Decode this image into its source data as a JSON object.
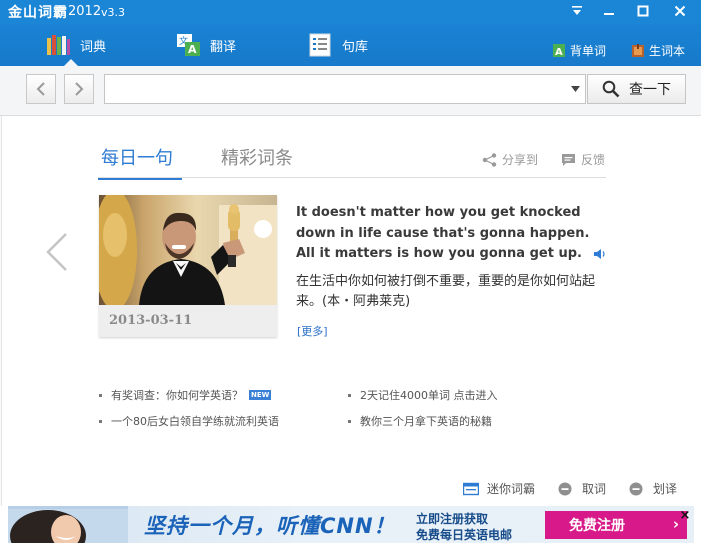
{
  "titlebar": {
    "logo": "金山词霸",
    "year": "2012",
    "version": "v3.3"
  },
  "toolbar": {
    "tabs": [
      {
        "label": "词典",
        "icon": "books-icon"
      },
      {
        "label": "翻译",
        "icon": "translate-icon"
      },
      {
        "label": "句库",
        "icon": "sentence-library-icon"
      }
    ],
    "right_links": [
      {
        "label": "背单词",
        "icon": "memorize-icon"
      },
      {
        "label": "生词本",
        "icon": "wordbook-icon"
      }
    ]
  },
  "search": {
    "value": "",
    "placeholder": "",
    "button_label": "查一下"
  },
  "content": {
    "tabs": [
      "每日一句",
      "精彩词条"
    ],
    "share_label": "分享到",
    "feedback_label": "反馈"
  },
  "daily": {
    "date": "2013-03-11",
    "sentence_en": "It doesn't matter how you get knocked down in life cause that's gonna happen. All it matters is how you gonna get up.",
    "sentence_cn": "在生活中你如何被打倒不重要，重要的是你如何站起来。(本・阿弗莱克)",
    "more_label": "[更多]"
  },
  "links": [
    {
      "text": "有奖调查：你如何学英语？",
      "badge": "NEW"
    },
    {
      "text": "2天记住4000单词 点击进入"
    },
    {
      "text": "一个80后女白领自学练就流利英语"
    },
    {
      "text": "教你三个月拿下英语的秘籍"
    }
  ],
  "tools": [
    {
      "label": "迷你词霸",
      "icon": "mini-dict-icon"
    },
    {
      "label": "取词",
      "icon": "capture-word-icon"
    },
    {
      "label": "划译",
      "icon": "select-translate-icon"
    }
  ],
  "ad": {
    "slogan": "坚持一个月，听懂CNN！",
    "line1": "立即注册获取",
    "line2": "免费每日英语电邮",
    "cta": "免费注册",
    "cta_arrow": "›",
    "close": "×"
  },
  "colors": {
    "titlebar": "#1b85d6",
    "accent": "#2e7cd3",
    "cta": "#d8198a"
  }
}
